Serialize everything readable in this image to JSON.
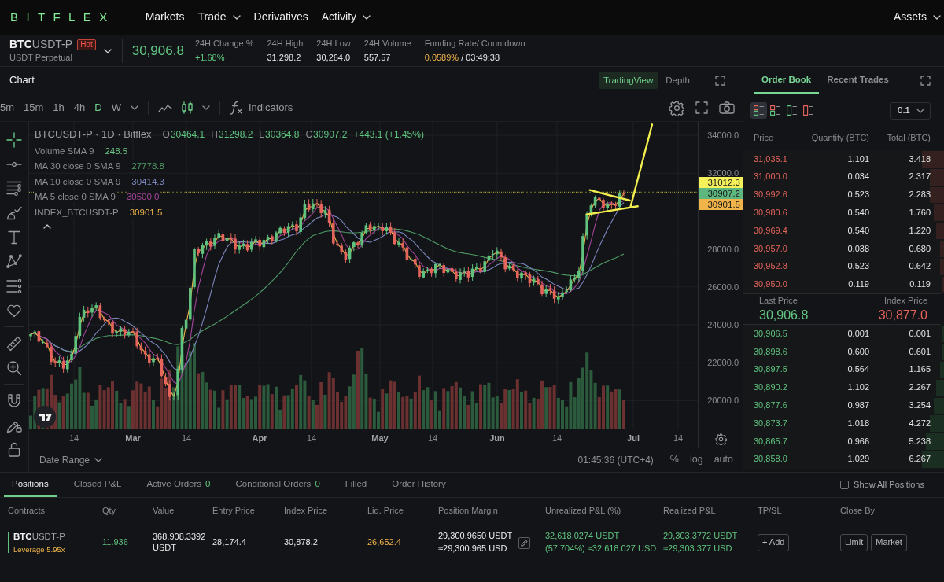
{
  "nav": {
    "logo": "BITFLEX",
    "items": [
      {
        "label": "Markets",
        "dropdown": false
      },
      {
        "label": "Trade",
        "dropdown": true
      },
      {
        "label": "Derivatives",
        "dropdown": false
      },
      {
        "label": "Activity",
        "dropdown": true
      }
    ],
    "account": {
      "label": "Assets",
      "dropdown": true
    }
  },
  "ticker": {
    "symbol": {
      "base": "BTC",
      "quote": "USDT-P"
    },
    "subtitle": "USDT Perpetual",
    "badge": "Hot",
    "last_price": "30,906.8",
    "stats": [
      {
        "kind": "stat",
        "label": "24H Change %",
        "value": "+1.68%",
        "positive": true
      },
      {
        "kind": "stat",
        "label": "24H High",
        "value": "31,298.2",
        "positive": false
      },
      {
        "kind": "stat",
        "label": "24H Low",
        "value": "30,264.0",
        "positive": false
      },
      {
        "kind": "stat",
        "label": "24H Volume",
        "value": "557.57",
        "positive": false
      },
      {
        "kind": "funding",
        "label": "Funding Rate/ Countdown",
        "rate": "0.0589%",
        "countdown": "/ 03:49:38"
      }
    ]
  },
  "chart": {
    "title": "Chart",
    "views": [
      {
        "label": "TradingView",
        "selected": true
      },
      {
        "label": "Depth",
        "selected": false
      }
    ],
    "intervals": [
      {
        "label": "5m",
        "selected": false
      },
      {
        "label": "15m",
        "selected": false
      },
      {
        "label": "1h",
        "selected": false
      },
      {
        "label": "4h",
        "selected": false
      },
      {
        "label": "D",
        "selected": true
      },
      {
        "label": "W",
        "selected": false
      }
    ],
    "styles": [
      {
        "kind": "line",
        "selected": false
      },
      {
        "kind": "candles",
        "selected": true
      }
    ],
    "indicators": "Indicators",
    "tool_groups": [
      [
        {
          "kind": "crosshair",
          "selected": true
        },
        {
          "kind": "ray",
          "selected": false
        },
        {
          "kind": "lines",
          "selected": false
        },
        {
          "kind": "brush",
          "selected": false
        },
        {
          "kind": "text",
          "selected": false
        },
        {
          "kind": "pattern",
          "selected": false
        },
        {
          "kind": "fib",
          "selected": false
        },
        {
          "kind": "heart",
          "selected": false
        }
      ],
      [
        {
          "kind": "ruler",
          "selected": false
        },
        {
          "kind": "zoom",
          "selected": false
        }
      ],
      [
        {
          "kind": "magnet",
          "selected": false
        },
        {
          "kind": "draw-lock",
          "selected": false
        },
        {
          "kind": "lock",
          "selected": false
        }
      ]
    ],
    "legend": {
      "title": "BTCUSDT-P · 1D · Bitflex",
      "ohlc": [
        {
          "key": "O",
          "value": "30464.1"
        },
        {
          "key": "H",
          "value": "31298.2"
        },
        {
          "key": "L",
          "value": "30364.8"
        },
        {
          "key": "C",
          "value": "30907.2"
        }
      ],
      "change": "+443.1 (+1.45%)",
      "series": [
        {
          "kind": "volume",
          "label": "Volume SMA 9",
          "value": "248.5",
          "color": "#6cc785"
        },
        {
          "kind": "ma-slow",
          "label": "MA 30 close 0 SMA 9",
          "value": "27778.8",
          "color": "#4f9a66"
        },
        {
          "kind": "ma-mid",
          "label": "MA 10 close 0 SMA 9",
          "value": "30414.3",
          "color": "#7d87bf"
        },
        {
          "kind": "ma-fast",
          "label": "MA 5 close 0 SMA 9",
          "value": "30500.0",
          "color": "#a3459b"
        },
        {
          "kind": "index",
          "label": "INDEX_BTCUSDT-P",
          "value": "30901.5",
          "color": "#f0b44a"
        }
      ]
    },
    "price_axis": [
      "34000.0",
      "32000.0",
      "28000.0",
      "26000.0",
      "24000.0",
      "22000.0",
      "20000.0"
    ],
    "price_tags": [
      {
        "value": "31012.3",
        "color": "#f5f15a"
      },
      {
        "value": "30907.2",
        "color": "#5db77f"
      },
      {
        "value": "30901.5",
        "color": "#f0b44a"
      }
    ],
    "time_axis": [
      {
        "kind": "day",
        "label": "14"
      },
      {
        "kind": "month",
        "label": "Mar"
      },
      {
        "kind": "day",
        "label": "14"
      },
      {
        "kind": "month",
        "label": "Apr"
      },
      {
        "kind": "day",
        "label": "14"
      },
      {
        "kind": "month",
        "label": "May"
      },
      {
        "kind": "day",
        "label": "14"
      },
      {
        "kind": "month",
        "label": "Jun"
      },
      {
        "kind": "day",
        "label": "14"
      },
      {
        "kind": "month",
        "label": "Jul"
      },
      {
        "kind": "day",
        "label": "14"
      }
    ],
    "date_range": "Date Range",
    "clock": "01:45:36 (UTC+4)",
    "scale_options": [
      "%",
      "log",
      "auto"
    ]
  },
  "order_book": {
    "tabs": [
      {
        "label": "Order Book",
        "selected": true
      },
      {
        "label": "Recent Trades",
        "selected": false
      }
    ],
    "views": [
      {
        "kind": "both",
        "selected": true
      },
      {
        "kind": "both",
        "selected": false
      },
      {
        "kind": "bids",
        "selected": false
      },
      {
        "kind": "asks",
        "selected": false
      }
    ],
    "precision": "0.1",
    "columns": [
      "Price",
      "Quantity (BTC)",
      "Total (BTC)"
    ],
    "asks": [
      {
        "price": "31,035.1",
        "quantity": "1.101",
        "total": "3.418",
        "level": 0.11
      },
      {
        "price": "31,000.0",
        "quantity": "0.034",
        "total": "2.317",
        "level": 0.07
      },
      {
        "price": "30,992.6",
        "quantity": "0.523",
        "total": "2.283",
        "level": 0.07
      },
      {
        "price": "30,980.6",
        "quantity": "0.540",
        "total": "1.760",
        "level": 0.05
      },
      {
        "price": "30,969.4",
        "quantity": "0.540",
        "total": "1.220",
        "level": 0.04
      },
      {
        "price": "30,957.0",
        "quantity": "0.038",
        "total": "0.680",
        "level": 0.02
      },
      {
        "price": "30,952.8",
        "quantity": "0.523",
        "total": "0.642",
        "level": 0.02
      },
      {
        "price": "30,950.0",
        "quantity": "0.119",
        "total": "0.119",
        "level": 0.01
      }
    ],
    "last_price": {
      "label": "Last Price",
      "value": "30,906.8"
    },
    "index_price": {
      "label": "Index Price",
      "value": "30,877.0"
    },
    "bids": [
      {
        "price": "30,906.5",
        "quantity": "0.001",
        "total": "0.001",
        "level": 0.01
      },
      {
        "price": "30,898.6",
        "quantity": "0.600",
        "total": "0.601",
        "level": 0.01
      },
      {
        "price": "30,897.5",
        "quantity": "0.564",
        "total": "1.165",
        "level": 0.02
      },
      {
        "price": "30,890.2",
        "quantity": "1.102",
        "total": "2.267",
        "level": 0.04
      },
      {
        "price": "30,877.6",
        "quantity": "0.987",
        "total": "3.254",
        "level": 0.05
      },
      {
        "price": "30,873.7",
        "quantity": "1.018",
        "total": "4.272",
        "level": 0.07
      },
      {
        "price": "30,865.7",
        "quantity": "0.966",
        "total": "5.238",
        "level": 0.09
      },
      {
        "price": "30,858.0",
        "quantity": "1.029",
        "total": "6.267",
        "level": 0.11
      }
    ]
  },
  "positions": {
    "tabs": [
      {
        "label": "Positions",
        "selected": true
      },
      {
        "label": "Closed P&L",
        "selected": false
      },
      {
        "label": "Active Orders",
        "count": "0",
        "selected": false
      },
      {
        "label": "Conditional Orders",
        "count": "0",
        "selected": false
      },
      {
        "label": "Filled",
        "selected": false
      },
      {
        "label": "Order History",
        "selected": false
      }
    ],
    "show_all": {
      "label": "Show All Positions",
      "checked": false
    },
    "columns": [
      "Contracts",
      "Qty",
      "Value",
      "Entry Price",
      "Index Price",
      "Liq. Price",
      "Position Margin",
      "Unrealized P&L (%)",
      "Realized P&L",
      "TP/SL",
      "Close By"
    ],
    "rows": [
      {
        "long": true,
        "symbol": {
          "base": "BTC",
          "quote": "USDT-P"
        },
        "leverage": "Leverage 5.95x",
        "qty": "11.936",
        "value": "368,908.3392 USDT",
        "entry_price": "28,174.4",
        "index_price": "30,878.2",
        "liq_price": "26,652.4",
        "margin": {
          "amount": "29,300.9650 USDT",
          "approx": "≈29,300.965 USD"
        },
        "unrealized": {
          "amount": "32,618.0274 USDT",
          "approx": "(57.704%) ≈32,618.027 USD"
        },
        "realized": {
          "amount": "29,303.3772 USDT",
          "approx": "≈29,303.377 USD"
        },
        "tp_sl": "+ Add",
        "close_by": [
          "Limit",
          "Market"
        ]
      }
    ]
  }
}
